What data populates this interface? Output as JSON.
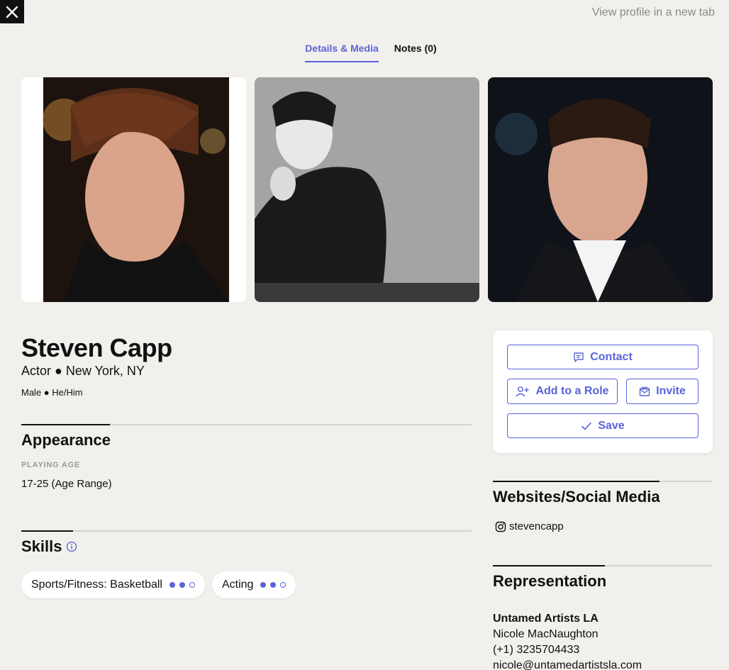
{
  "header": {
    "close_icon": "close-icon",
    "view_profile_link": "View profile in a new tab"
  },
  "tabs": [
    {
      "label": "Details & Media",
      "active": true
    },
    {
      "label": "Notes (0)",
      "active": false
    }
  ],
  "profile": {
    "name": "Steven Capp",
    "subtitle": "Actor ● New York, NY",
    "details": "Male ● He/Him"
  },
  "appearance": {
    "title": "Appearance",
    "playing_age_label": "PLAYING AGE",
    "playing_age_value": "17-25 (Age Range)"
  },
  "skills": {
    "title": "Skills",
    "info_icon": "info-icon",
    "items": [
      {
        "label": "Sports/Fitness: Basketball",
        "level": 2,
        "max": 3
      },
      {
        "label": "Acting",
        "level": 2,
        "max": 3
      }
    ]
  },
  "actions": {
    "contact_label": "Contact",
    "add_to_role_label": "Add to a Role",
    "invite_label": "Invite",
    "save_label": "Save"
  },
  "websites": {
    "title": "Websites/Social Media",
    "instagram_handle": "stevencapp"
  },
  "representation": {
    "title": "Representation",
    "agency": "Untamed Artists LA",
    "agent": "Nicole MacNaughton",
    "phone": "(+1) 3235704433",
    "email": "nicole@untamedartistsla.com"
  },
  "colors": {
    "accent": "#5a63d8",
    "background": "#f2f0ec"
  }
}
